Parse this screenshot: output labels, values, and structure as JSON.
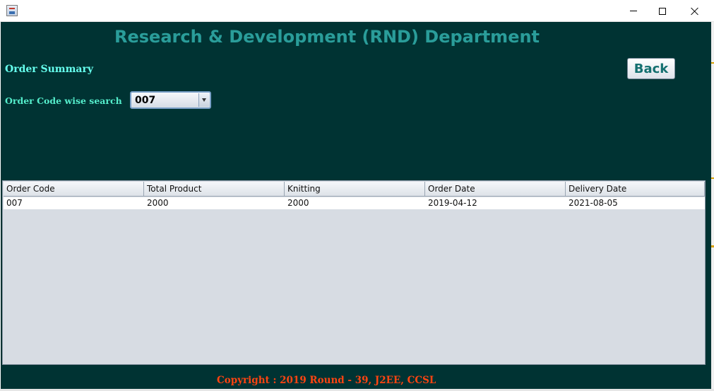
{
  "window": {
    "minimize_icon": "minimize-icon",
    "maximize_icon": "maximize-icon",
    "close_icon": "close-icon"
  },
  "header": {
    "title": "Research & Development (RND) Department"
  },
  "summary": {
    "label": "Order Summary"
  },
  "search": {
    "label": "Order Code wise search",
    "selected": "007"
  },
  "toolbar": {
    "back_label": "Back"
  },
  "table": {
    "columns": [
      "Order Code",
      "Total Product",
      "Knitting",
      "Order Date",
      "Delivery Date"
    ],
    "rows": [
      [
        "007",
        "2000",
        "2000",
        "2019-04-12",
        "2021-08-05"
      ]
    ]
  },
  "footer": {
    "copyright": "Copyright : 2019 Round - 39, J2EE, CCSL"
  },
  "colors": {
    "panel_bg": "#003333",
    "title": "#2a9d9a",
    "summary": "#66ffee",
    "copyright": "#ff4411"
  }
}
